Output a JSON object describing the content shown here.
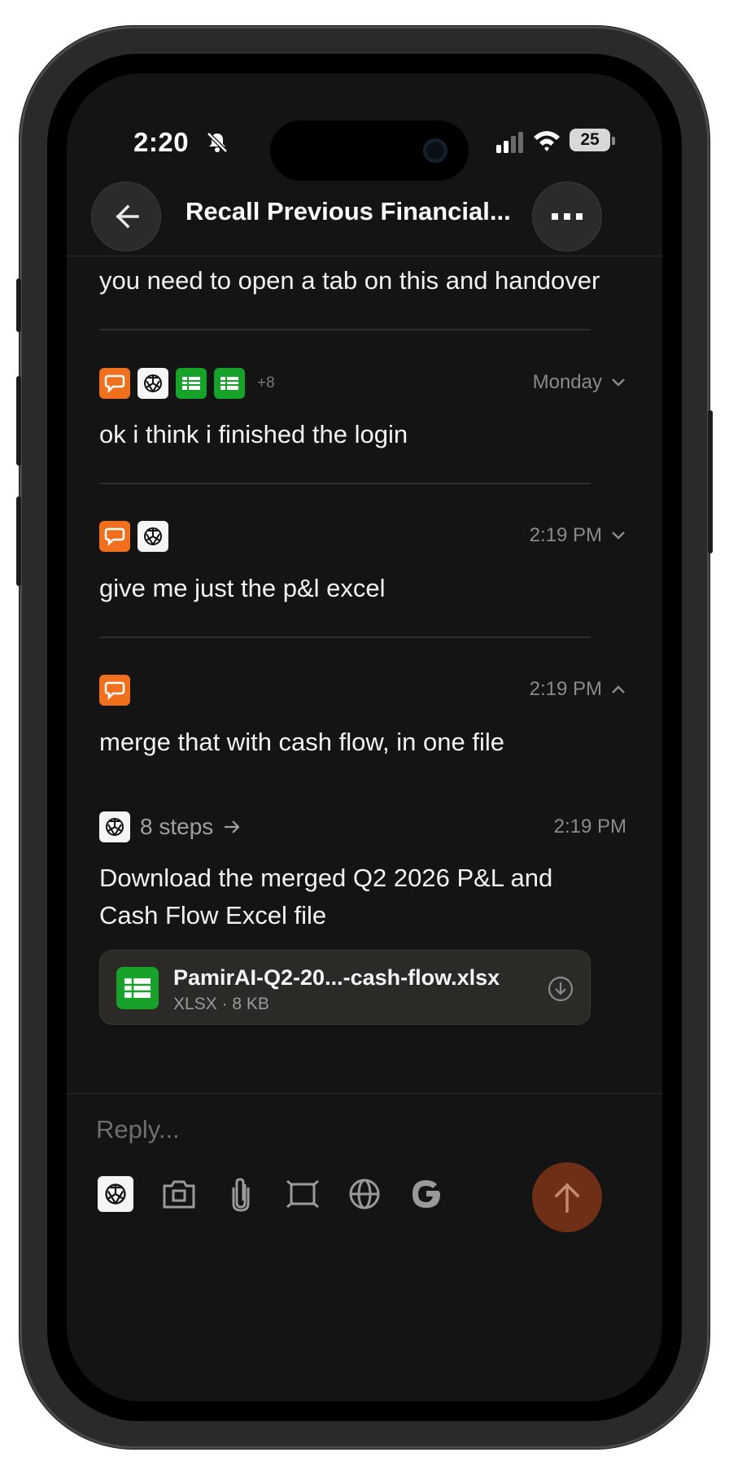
{
  "status_bar": {
    "time": "2:20",
    "battery": "25"
  },
  "header": {
    "title": "Recall Previous Financial..."
  },
  "messages": [
    {
      "text": "you need to open a tab on this and handover"
    },
    {
      "extra_count": "+8",
      "timestamp": "Monday",
      "text": "ok i think i finished the login"
    },
    {
      "timestamp": "2:19 PM",
      "text": "give me just the p&l excel"
    },
    {
      "timestamp": "2:19 PM",
      "text": "merge that with cash flow, in one file"
    }
  ],
  "response": {
    "steps_label": "8 steps",
    "timestamp": "2:19 PM",
    "text": "Download the merged Q2 2026 P&L and Cash Flow Excel file",
    "file": {
      "name": "PamirAI-Q2-20...-cash-flow.xlsx",
      "meta": "XLSX · 8 KB"
    }
  },
  "composer": {
    "placeholder": "Reply..."
  },
  "icons": {
    "app_icons": [
      "chat-bubble-icon",
      "openai-icon",
      "spreadsheet-icon"
    ],
    "toolbar": [
      "openai-icon",
      "camera-icon",
      "paperclip-icon",
      "screenshot-icon",
      "globe-icon",
      "google-icon"
    ],
    "send": "arrow-up-icon"
  },
  "colors": {
    "background": "#141414",
    "chat_icon": "#f0701e",
    "sheet_icon": "#17a22a",
    "send_button": "#6e2f16",
    "file_card": "#2c2a26"
  }
}
